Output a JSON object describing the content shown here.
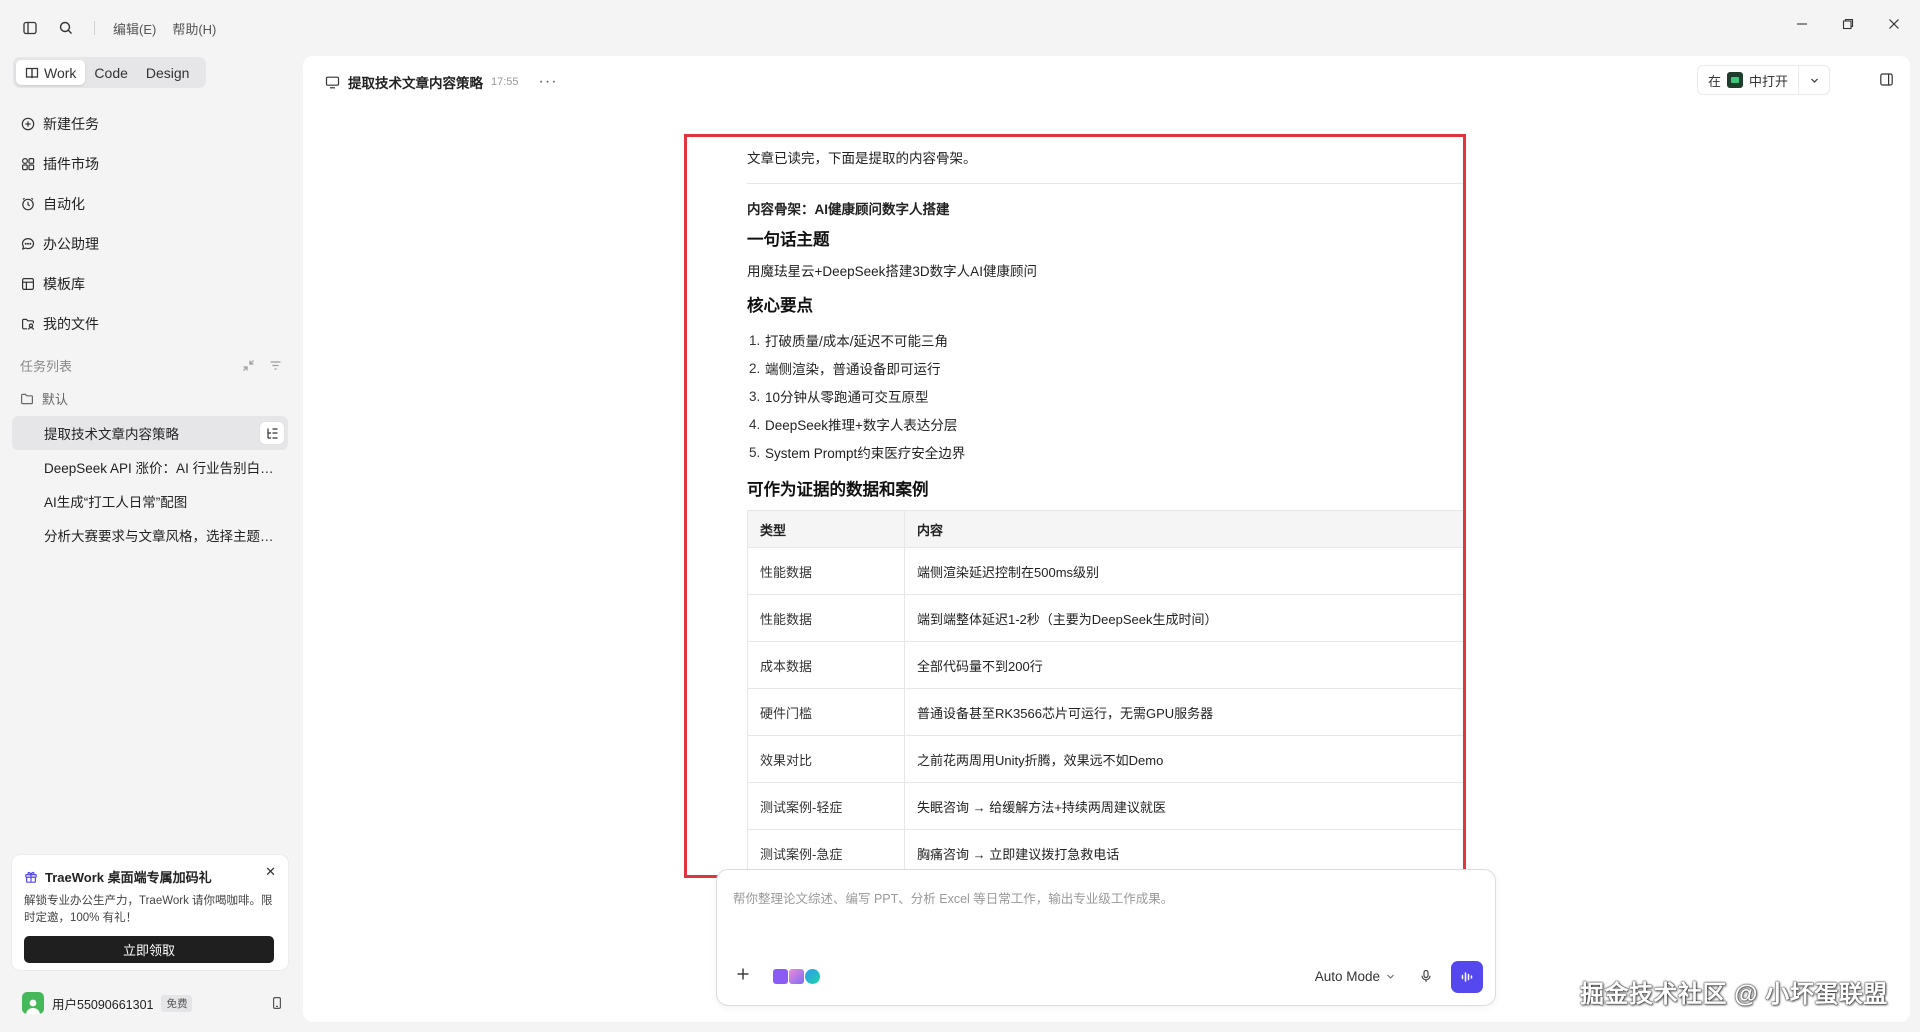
{
  "titlebar": {
    "menus": [
      "编辑(E)",
      "帮助(H)"
    ]
  },
  "sidebar": {
    "mode_tabs": [
      "Work",
      "Code",
      "Design"
    ],
    "nav": [
      {
        "label": "新建任务",
        "icon": "plus-circle-icon"
      },
      {
        "label": "插件市场",
        "icon": "plugin-icon"
      },
      {
        "label": "自动化",
        "icon": "clock-icon"
      },
      {
        "label": "办公助理",
        "icon": "chat-icon"
      },
      {
        "label": "模板库",
        "icon": "template-icon"
      },
      {
        "label": "我的文件",
        "icon": "folder-user-icon"
      }
    ],
    "task_list_title": "任务列表",
    "folder": "默认",
    "tasks": [
      "提取技术文章内容策略",
      "DeepSeek API 涨价：AI 行业告别白嫖时代",
      "AI生成“打工人日常”配图",
      "分析大赛要求与文章风格，选择主题方向"
    ],
    "promo": {
      "title": "TraeWork 桌面端专属加码礼",
      "desc": "解锁专业办公生产力，TraeWork 请你喝咖啡。限时定邀，100% 有礼！",
      "button": "立即领取"
    },
    "user": {
      "name": "用户55090661301",
      "badge": "免费"
    }
  },
  "main": {
    "chat_title": "提取技术文章内容策略",
    "chat_time": "17:55",
    "open_in_prefix": "在",
    "open_in_suffix": "中打开"
  },
  "content": {
    "intro": "文章已读完，下面是提取的内容骨架。",
    "skeleton_title": "内容骨架：AI健康顾问数字人搭建",
    "h_theme": "一句话主题",
    "theme": "用魔珐星云+DeepSeek搭建3D数字人AI健康顾问",
    "h_points": "核心要点",
    "points": [
      "打破质量/成本/延迟不可能三角",
      "端侧渲染，普通设备即可运行",
      "10分钟从零跑通可交互原型",
      "DeepSeek推理+数字人表达分层",
      "System Prompt约束医疗安全边界"
    ],
    "h_evidence": "可作为证据的数据和案例",
    "table": {
      "headers": [
        "类型",
        "内容"
      ],
      "rows": [
        [
          "性能数据",
          "端侧渲染延迟控制在500ms级别"
        ],
        [
          "性能数据",
          "端到端整体延迟1-2秒（主要为DeepSeek生成时间）"
        ],
        [
          "成本数据",
          "全部代码量不到200行"
        ],
        [
          "硬件门槛",
          "普通设备甚至RK3566芯片可运行，无需GPU服务器"
        ],
        [
          "效果对比",
          "之前花两周用Unity折腾，效果远不如Demo"
        ],
        [
          "测试案例-轻症",
          "失眠咨询 → 给缓解方法+持续两周建议就医"
        ],
        [
          "测试案例-急症",
          "胸痛咨询 → 立即建议拨打急救电话"
        ]
      ]
    }
  },
  "composer": {
    "placeholder": "帮你整理论文综述、编写 PPT、分析 Excel 等日常工作，输出专业级工作成果。",
    "mode": "Auto Mode"
  },
  "watermark": "掘金技术社区 @ 小坏蛋联盟",
  "colors": {
    "accent": "#5548ef",
    "highlight_border": "#e0353f",
    "avatar": "#45b85a"
  }
}
